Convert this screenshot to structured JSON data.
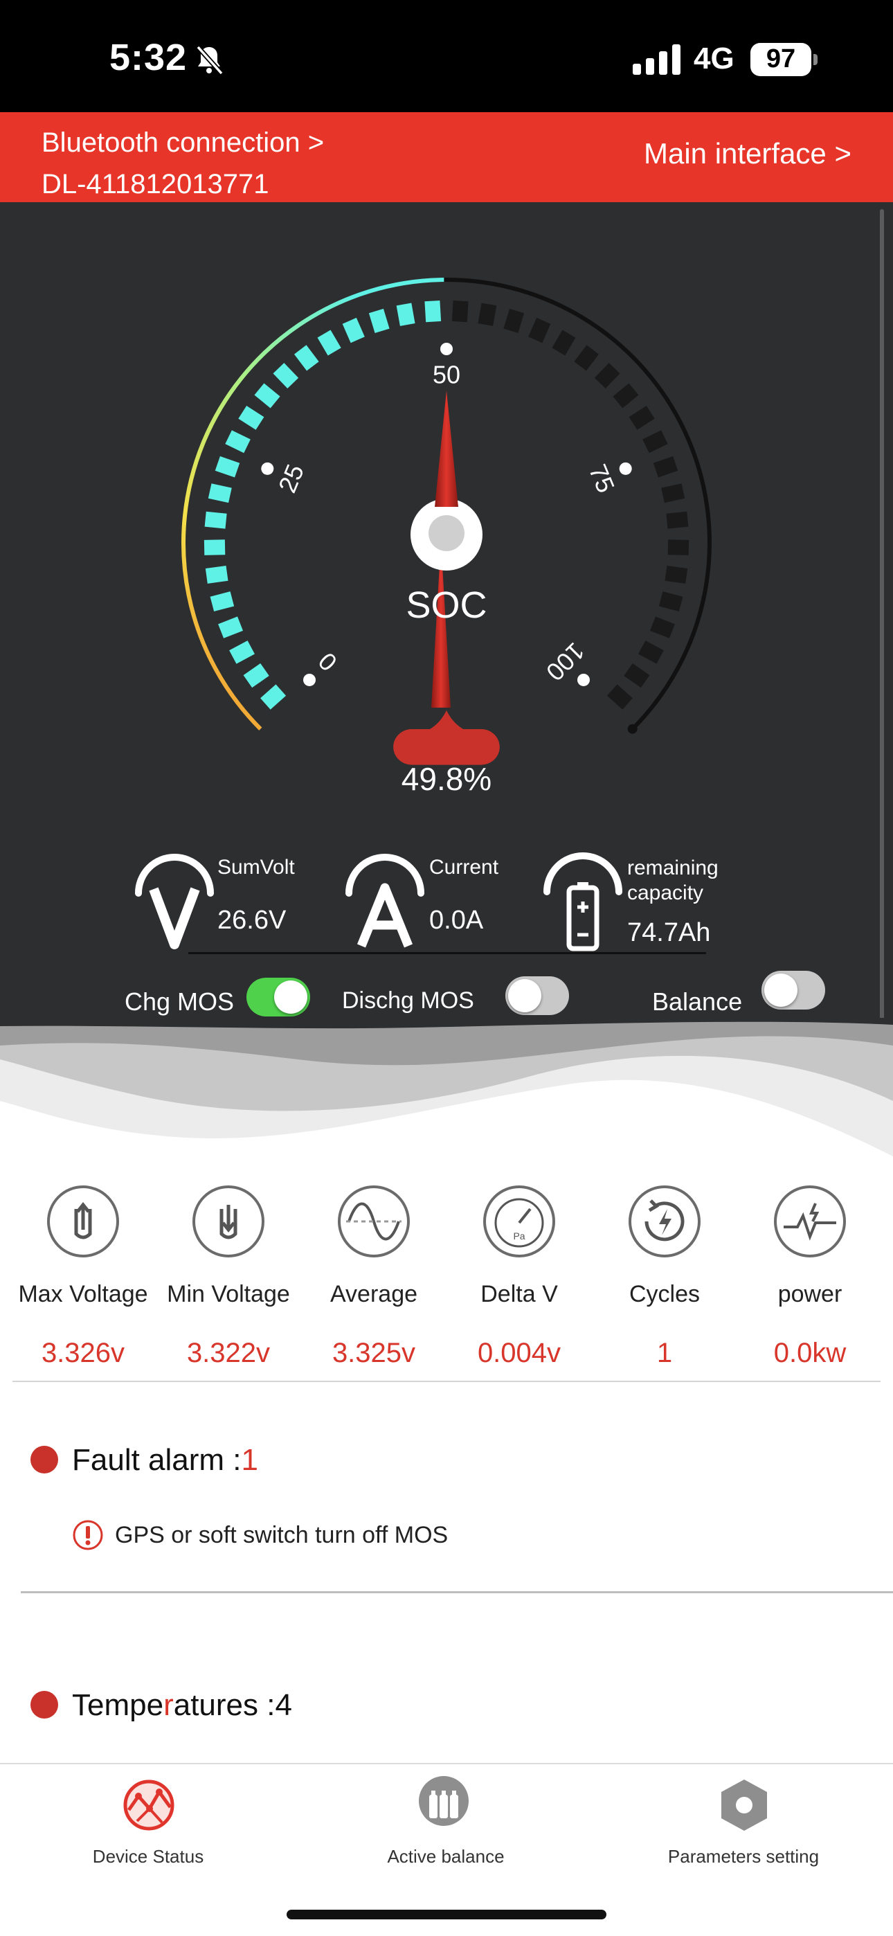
{
  "status_bar": {
    "time": "5:32",
    "network": "4G",
    "battery": "97"
  },
  "header": {
    "bluetooth_label": "Bluetooth connection >",
    "device_id": "DL-411812013771",
    "main_interface": "Main interface >"
  },
  "gauge": {
    "label": "SOC",
    "ticks": [
      "0",
      "25",
      "50",
      "75",
      "100"
    ],
    "soc_percent": 49.8,
    "soc_display": "49.8%"
  },
  "metrics": {
    "sumvolt_label": "SumVolt",
    "sumvolt_value": "26.6V",
    "current_label": "Current",
    "current_value": "0.0A",
    "capacity_label_1": "remaining",
    "capacity_label_2": "capacity",
    "capacity_value": "74.7Ah"
  },
  "switches": {
    "chg_label": "Chg MOS",
    "chg_on": true,
    "dischg_label": "Dischg MOS",
    "dischg_on": false,
    "balance_label": "Balance",
    "balance_on": false
  },
  "stats": [
    {
      "icon": "max-voltage-icon",
      "label": "Max Voltage",
      "value": "3.326v"
    },
    {
      "icon": "min-voltage-icon",
      "label": "Min Voltage",
      "value": "3.322v"
    },
    {
      "icon": "average-icon",
      "label": "Average",
      "value": "3.325v"
    },
    {
      "icon": "delta-v-icon",
      "label": "Delta V",
      "value": "0.004v"
    },
    {
      "icon": "cycles-icon",
      "label": "Cycles",
      "value": "1"
    },
    {
      "icon": "power-icon",
      "label": "power",
      "value": "0.0kw"
    }
  ],
  "fault": {
    "title": "Fault alarm :",
    "count": "1",
    "message": "GPS or soft switch turn off MOS"
  },
  "temperatures": {
    "title_a": "Tempe",
    "title_b": "r",
    "title_c": "atures :4"
  },
  "nav": [
    {
      "label": "Device Status",
      "icon": "device-status-icon"
    },
    {
      "label": "Active balance",
      "icon": "active-balance-icon"
    },
    {
      "label": "Parameters setting",
      "icon": "parameters-setting-icon"
    }
  ],
  "colors": {
    "accent": "#e8352a",
    "value_red": "#d8352b",
    "cyan": "#5ff0e6",
    "panel": "#2d2e30"
  }
}
